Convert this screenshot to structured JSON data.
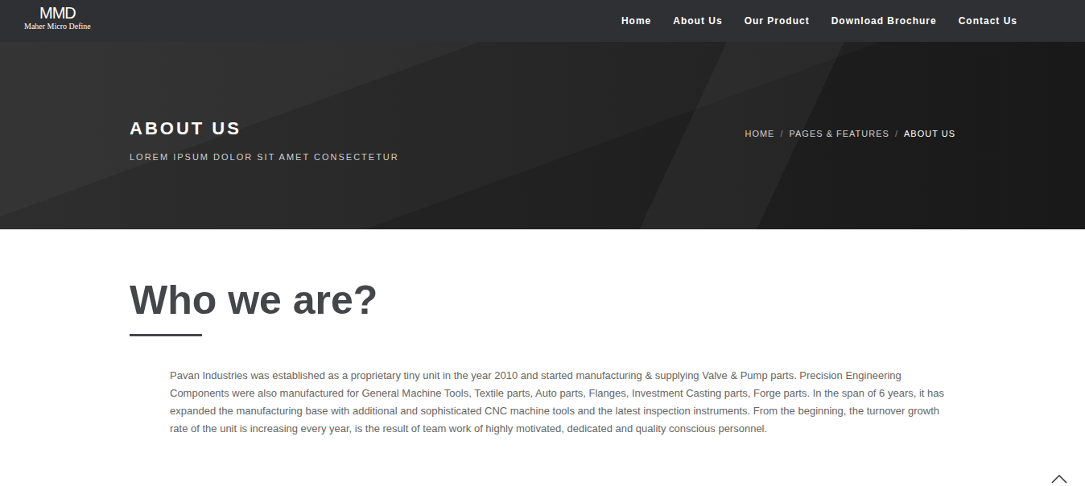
{
  "header": {
    "logo": {
      "mark": "MMD",
      "name": "Maher Micro Define"
    },
    "nav": [
      {
        "label": "Home"
      },
      {
        "label": "About Us"
      },
      {
        "label": "Our Product"
      },
      {
        "label": "Download Brochure"
      },
      {
        "label": "Contact Us"
      }
    ]
  },
  "banner": {
    "title": "ABOUT US",
    "subtitle": "LOREM IPSUM DOLOR SIT AMET CONSECTETUR",
    "breadcrumb": {
      "separator": "/",
      "items": [
        {
          "label": "HOME",
          "current": false
        },
        {
          "label": "PAGES & FEATURES",
          "current": false
        },
        {
          "label": "ABOUT US",
          "current": true
        }
      ]
    }
  },
  "section": {
    "heading": "Who we are?",
    "body": "Pavan Industries was established as a proprietary tiny unit in the year 2010 and started manufacturing & supplying Valve & Pump parts. Precision Engineering Components were also manufactured for General Machine Tools, Textile parts, Auto parts, Flanges, Investment Casting parts, Forge parts. In the span of 6 years, it has expanded the manufacturing base with additional and sophisticated CNC machine tools and the latest inspection instruments. From the beginning, the turnover growth rate of the unit is increasing every year, is the result of team work of highly motivated, dedicated and quality conscious personnel."
  }
}
